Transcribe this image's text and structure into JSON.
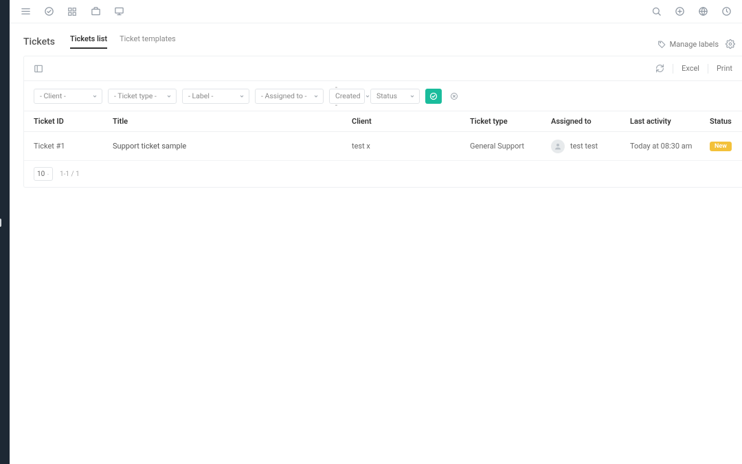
{
  "page": {
    "title": "Tickets"
  },
  "tabs": {
    "list": "Tickets list",
    "templates": "Ticket templates"
  },
  "header": {
    "manage_labels": "Manage labels"
  },
  "toolbar": {
    "excel": "Excel",
    "print": "Print"
  },
  "filters": {
    "client": "- Client -",
    "ticket_type": "- Ticket type -",
    "label": "- Label -",
    "assigned_to": "- Assigned to -",
    "created": "- Created -",
    "status": "Status"
  },
  "columns": {
    "ticket_id": "Ticket ID",
    "title": "Title",
    "client": "Client",
    "ticket_type": "Ticket type",
    "assigned_to": "Assigned to",
    "last_activity": "Last activity",
    "status": "Status"
  },
  "rows": [
    {
      "id": "Ticket #1",
      "title": "Support ticket sample",
      "client": "test x",
      "type": "General Support",
      "assignee": "test test",
      "activity": "Today at 08:30 am",
      "status": "New"
    }
  ],
  "pager": {
    "page_size": "10",
    "info": "1-1 / 1"
  },
  "status_color": "#f3c13a"
}
